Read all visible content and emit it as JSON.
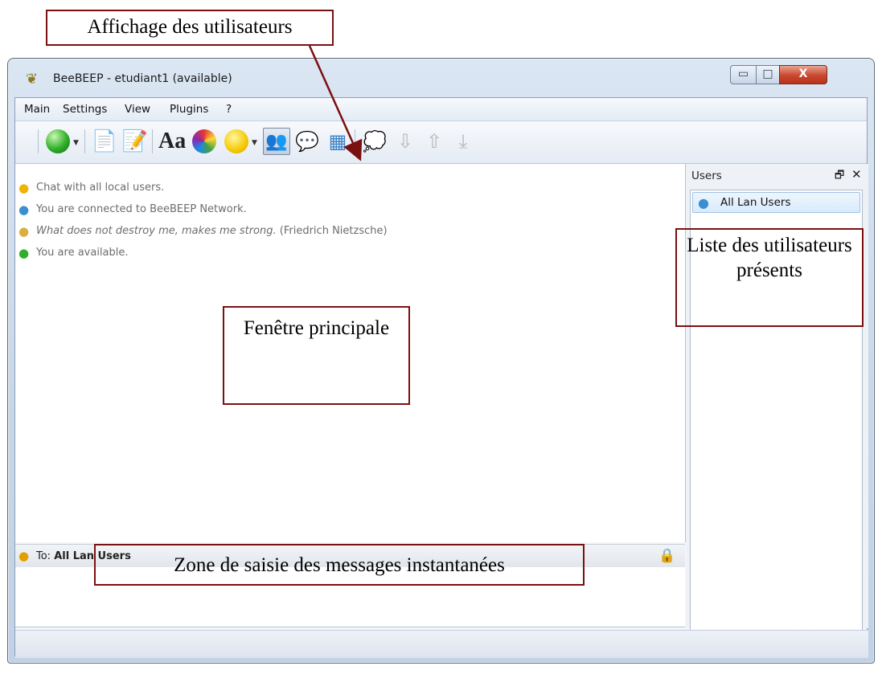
{
  "annotations": {
    "users_button": "Affichage des utilisateurs",
    "main_window": "Fenêtre principale",
    "users_list": "Liste des utilisateurs présents",
    "input_zone": "Zone de saisie des messages instantanées"
  },
  "window": {
    "title": "BeeBEEP - etudiant1 (available)",
    "buttons": {
      "minimize": "▭",
      "maximize": "□",
      "close": "X"
    }
  },
  "menu": [
    "Main",
    "Settings",
    "View",
    "Plugins",
    "?"
  ],
  "toolbar": {
    "icons": [
      "status-green-icon",
      "send-file-icon",
      "edit-icon",
      "font-icon",
      "color-icon",
      "emoticon-icon",
      "users-icon",
      "chat-icon",
      "list-icon",
      "quote-icon",
      "download-icon",
      "upload-icon",
      "check-download-icon"
    ],
    "font_glyph": "Aa",
    "active": "users-icon"
  },
  "chat": {
    "lines": [
      {
        "icon": "chat-bubble-icon",
        "text": "Chat with all local users."
      },
      {
        "icon": "globe-icon",
        "text": "You are connected to BeeBEEP Network."
      },
      {
        "icon": "bee-icon",
        "quote": "What does not destroy me, makes me strong.",
        "author": "(Friedrich Nietzsche)"
      },
      {
        "icon": "green-dot-icon",
        "text": "You are available."
      }
    ]
  },
  "message_bar": {
    "prefix": "To:",
    "recipient": "All Lan Users"
  },
  "users_dock": {
    "title": "Users",
    "float_glyph": "🗗",
    "close_glyph": "✕",
    "items": [
      {
        "label": "All Lan Users",
        "icon": "globe-icon"
      }
    ]
  },
  "colors": {
    "annotation_border": "#7a1010",
    "close_button": "#c9472f",
    "selection": "#d9ebfb"
  }
}
